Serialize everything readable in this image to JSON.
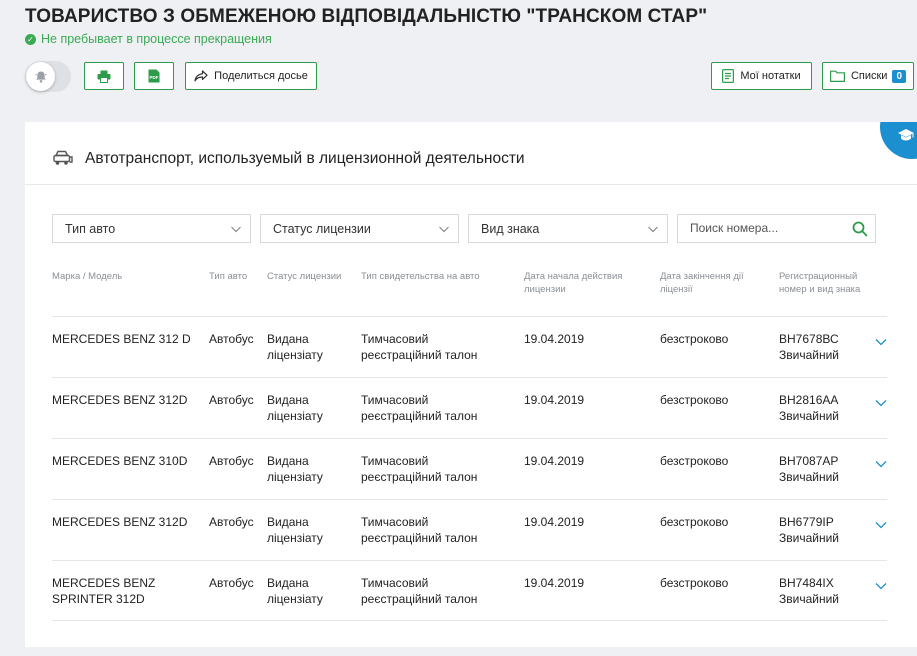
{
  "header": {
    "company_name": "ТОВАРИСТВО З ОБМЕЖЕНОЮ ВІДПОВІДАЛЬНІСТЮ \"ТРАНСКОМ СТАР\"",
    "status_text": "Не пребывает в процессе прекращения",
    "status_color": "#3aaa54"
  },
  "toolbar": {
    "print_icon": "printer-icon",
    "pdf_label": "PDF",
    "share_label": "Поделиться досье",
    "notes_label": "Мої нотатки",
    "lists_label": "Списки",
    "lists_count": "0"
  },
  "section": {
    "title": "Автотранспорт, используемый в лицензионной деятельности",
    "accent_color": "#1b8fd0"
  },
  "filters": {
    "car_type": "Тип авто",
    "license_status": "Статус лицензии",
    "sign_type": "Вид знака",
    "search_placeholder": "Поиск номера..."
  },
  "table": {
    "columns": [
      "Марка / Модель",
      "Тип авто",
      "Статус лицензии",
      "Тип свидетельства на авто",
      "Дата начала действия лицензии",
      "Дата закінчення дії ліцензії",
      "Регистрационный номер и вид знака"
    ],
    "rows": [
      {
        "model": "MERCEDES BENZ 312 D",
        "type": "Автобус",
        "status": "Видана ліцензіату",
        "cert": "Тимчасовий реєстраційний талон",
        "start": "19.04.2019",
        "end": "безстроково",
        "reg": "ВН7678ВС Звичайний"
      },
      {
        "model": "MERCEDES BENZ 312D",
        "type": "Автобус",
        "status": "Видана ліцензіату",
        "cert": "Тимчасовий реєстраційний талон",
        "start": "19.04.2019",
        "end": "безстроково",
        "reg": "ВН2816АА Звичайний"
      },
      {
        "model": "MERCEDES BENZ 310D",
        "type": "Автобус",
        "status": "Видана ліцензіату",
        "cert": "Тимчасовий реєстраційний талон",
        "start": "19.04.2019",
        "end": "безстроково",
        "reg": "ВН7087АР Звичайний"
      },
      {
        "model": "MERCEDES BENZ 312D",
        "type": "Автобус",
        "status": "Видана ліцензіату",
        "cert": "Тимчасовий реєстраційний талон",
        "start": "19.04.2019",
        "end": "безстроково",
        "reg": "ВН6779ІР Звичайний"
      },
      {
        "model": "MERCEDES BENZ SPRINTER 312D",
        "type": "Автобус",
        "status": "Видана ліцензіату",
        "cert": "Тимчасовий реєстраційний талон",
        "start": "19.04.2019",
        "end": "безстроково",
        "reg": "ВН7484ІХ Звичайний"
      }
    ]
  }
}
